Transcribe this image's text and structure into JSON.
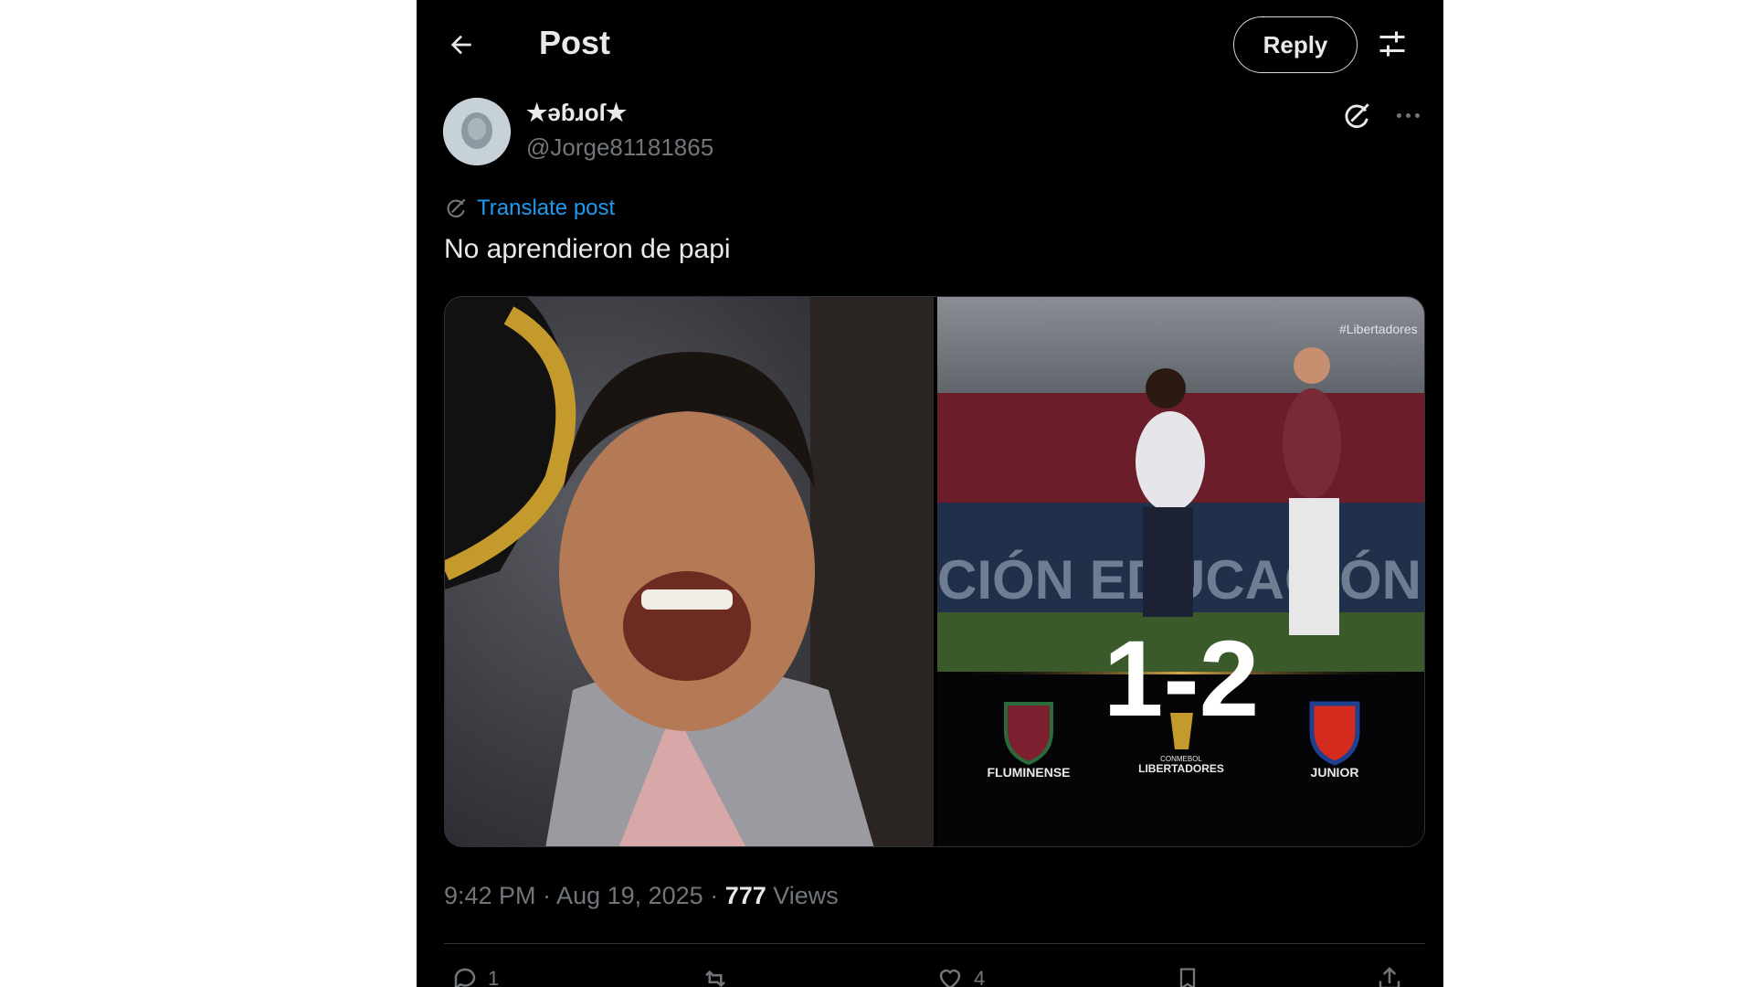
{
  "header": {
    "title": "Post",
    "reply_label": "Reply"
  },
  "author": {
    "name": "★ǝɓɹoſ★",
    "handle": "@Jorge81181865"
  },
  "post": {
    "translate_label": "Translate post",
    "text": "No aprendieron de papi"
  },
  "media": {
    "right": {
      "watermark": "#Libertadores",
      "banner_text": "CIÓN EDUCACIÓN",
      "score": "1-2",
      "home_team": "FLUMINENSE",
      "competition_small": "CONMEBOL",
      "competition": "LIBERTADORES",
      "away_team": "JUNIOR"
    }
  },
  "meta": {
    "time_date": "9:42 PM · Aug 19, 2025 · ",
    "views_count": "777",
    "views_label": " Views"
  },
  "actions": {
    "replies": "1",
    "reposts": "",
    "likes": "4"
  },
  "colors": {
    "accent": "#1d9bf0",
    "muted": "#71767b",
    "background": "#000000"
  }
}
